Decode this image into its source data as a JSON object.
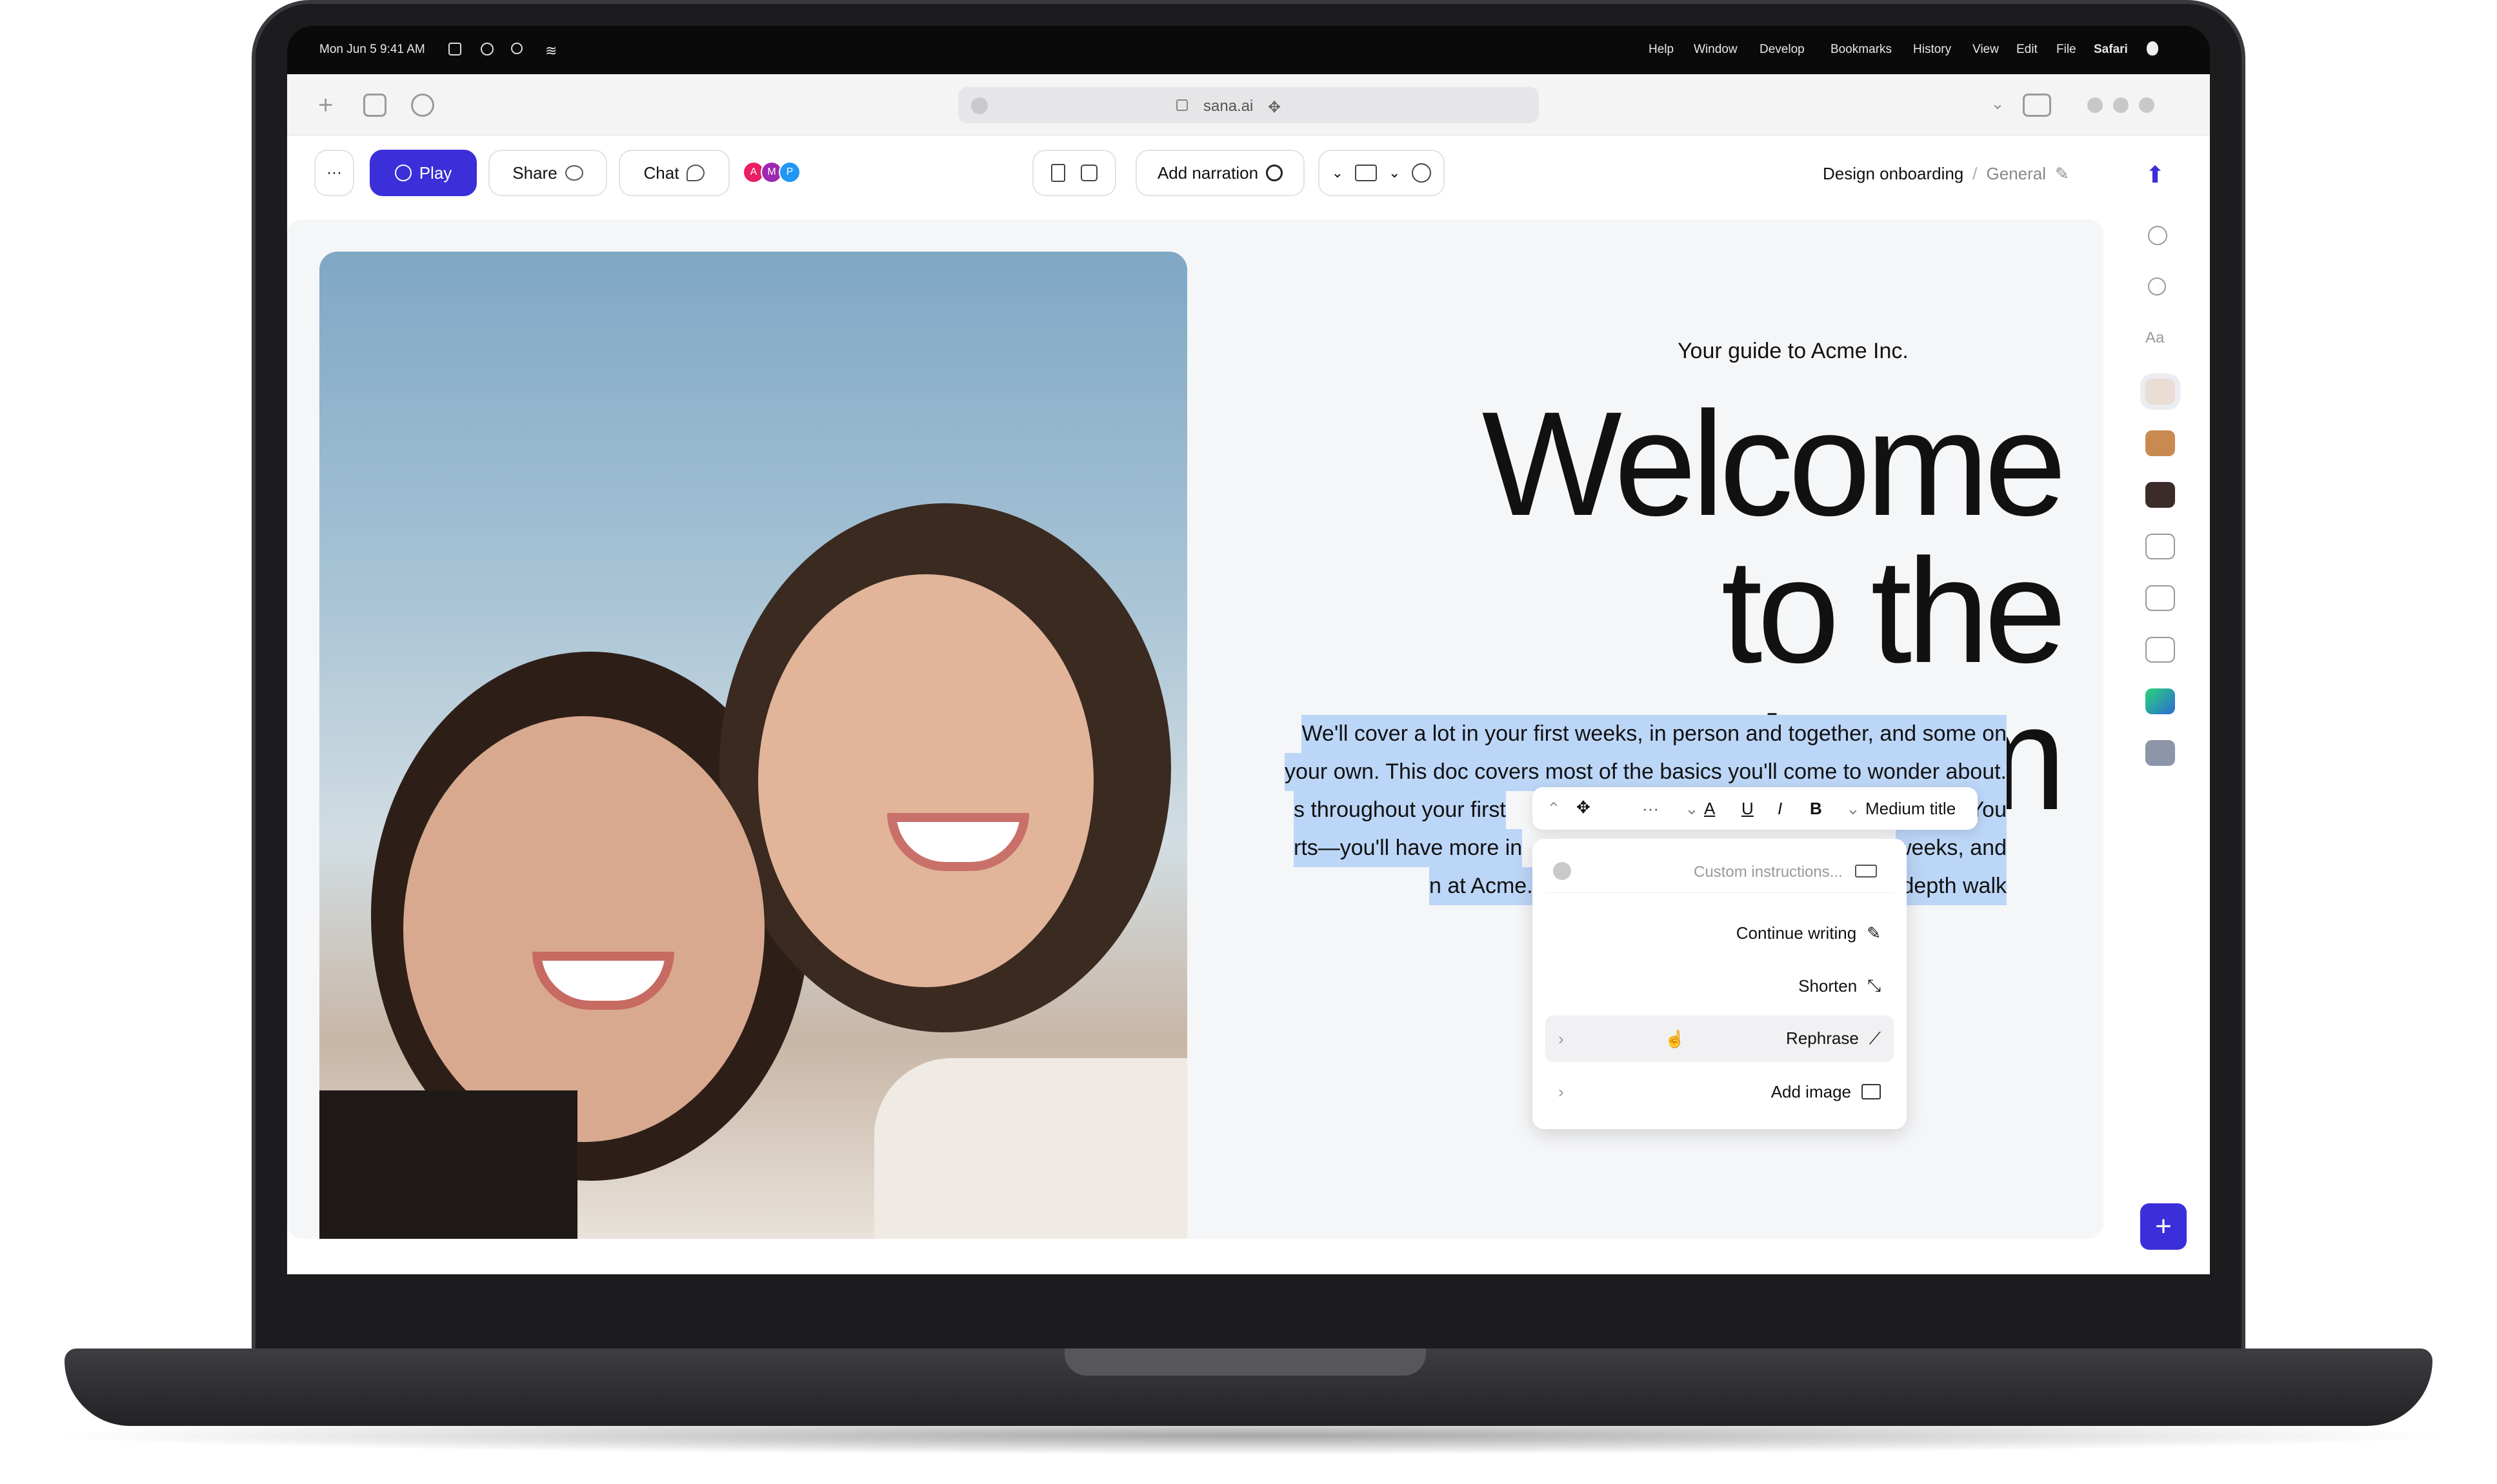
{
  "menubar": {
    "apple_glyph": "",
    "app_menus": [
      "Safari",
      "File",
      "Edit",
      "View",
      "History",
      "Bookmarks",
      "Develop",
      "Window",
      "Help"
    ],
    "clock": "Mon Jun 5  9:41 AM"
  },
  "browser": {
    "url": "sana.ai"
  },
  "toolbar": {
    "breadcrumb_parent": "General",
    "breadcrumb_separator": "/",
    "breadcrumb_current": "Design onboarding",
    "add_narration_label": "Add narration",
    "avatars": [
      "A",
      "M",
      "P"
    ],
    "chat_label": "Chat",
    "share_label": "Share",
    "play_label": "Play",
    "more_label": "···"
  },
  "slide": {
    "eyebrow": "Your guide to Acme Inc.",
    "title_line1": "Welcome",
    "title_line2": "to the team",
    "body_lines": [
      "We'll cover a lot in your first weeks, in person and together, and some on",
      "your own. This doc covers most of the basics you'll come to wonder about.",
      "You",
      "s throughout your first",
      "weeks, and",
      "rts—you'll have more in",
      "depth walk",
      "n at Acme."
    ]
  },
  "format_toolbar": {
    "style_label": "Medium title",
    "bold": "B",
    "italic": "I",
    "underline": "U",
    "color": "A",
    "more": "···"
  },
  "ai_menu": {
    "placeholder": "Custom instructions...",
    "items": [
      {
        "label": "Continue writing",
        "icon": "pen-icon"
      },
      {
        "label": "Shorten",
        "icon": "shrink-icon"
      },
      {
        "label": "Rephrase",
        "icon": "rephrase-icon",
        "has_submenu": true
      },
      {
        "label": "Add image",
        "icon": "image-icon",
        "has_submenu": true
      }
    ]
  },
  "colors": {
    "accent": "#3b2fd9",
    "selection": "#bcd6f7",
    "sidebar_logo": "#3b2fd9"
  }
}
